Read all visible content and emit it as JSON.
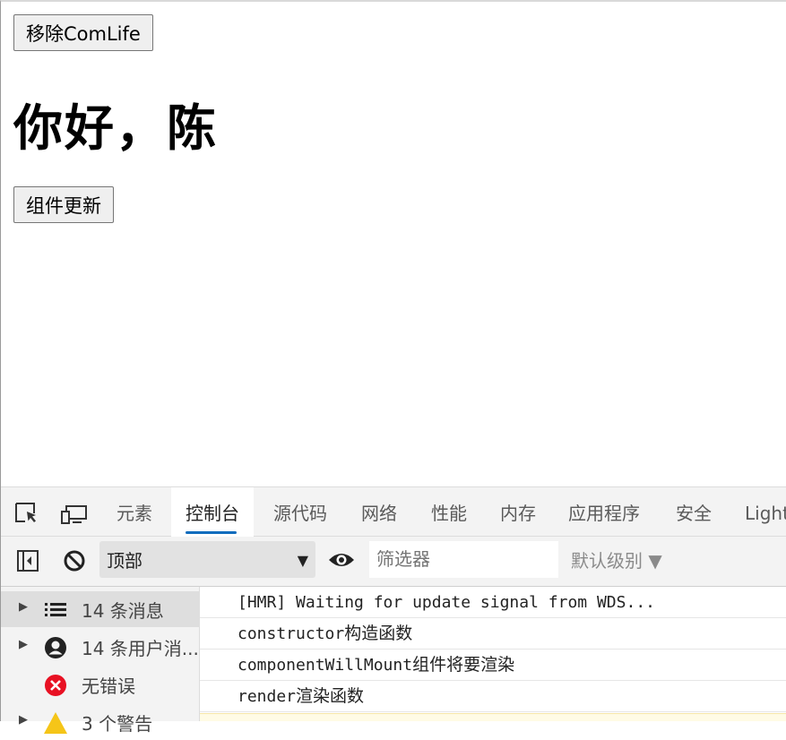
{
  "page": {
    "remove_button": "移除ComLife",
    "greeting": "你好，陈",
    "update_button": "组件更新"
  },
  "devtools": {
    "tabs": [
      {
        "label": "元素",
        "active": false
      },
      {
        "label": "控制台",
        "active": true
      },
      {
        "label": "源代码",
        "active": false
      },
      {
        "label": "网络",
        "active": false
      },
      {
        "label": "性能",
        "active": false
      },
      {
        "label": "内存",
        "active": false
      },
      {
        "label": "应用程序",
        "active": false
      },
      {
        "label": "安全",
        "active": false
      },
      {
        "label": "Light",
        "active": false
      }
    ],
    "toolbar": {
      "context": "顶部",
      "filter_placeholder": "筛选器",
      "level": "默认级别 ▼"
    },
    "sidebar": [
      {
        "label": "14 条消息",
        "icon": "list-icon",
        "selected": true
      },
      {
        "label": "14 条用户消...",
        "icon": "user-icon",
        "selected": false
      },
      {
        "label": "无错误",
        "icon": "error-icon",
        "selected": false
      },
      {
        "label": "3 个警告",
        "icon": "warning-icon",
        "selected": false
      }
    ],
    "logs": [
      {
        "code": "[HMR] Waiting for update signal from WDS...",
        "text": ""
      },
      {
        "code": "constructor",
        "text": "构造函数"
      },
      {
        "code": "componentWillMount",
        "text": "组件将要渲染"
      },
      {
        "code": "render",
        "text": "渲染函数"
      }
    ],
    "colors": {
      "accent": "#0f6cbd",
      "error": "#e81123",
      "warning": "#f5c518"
    }
  }
}
